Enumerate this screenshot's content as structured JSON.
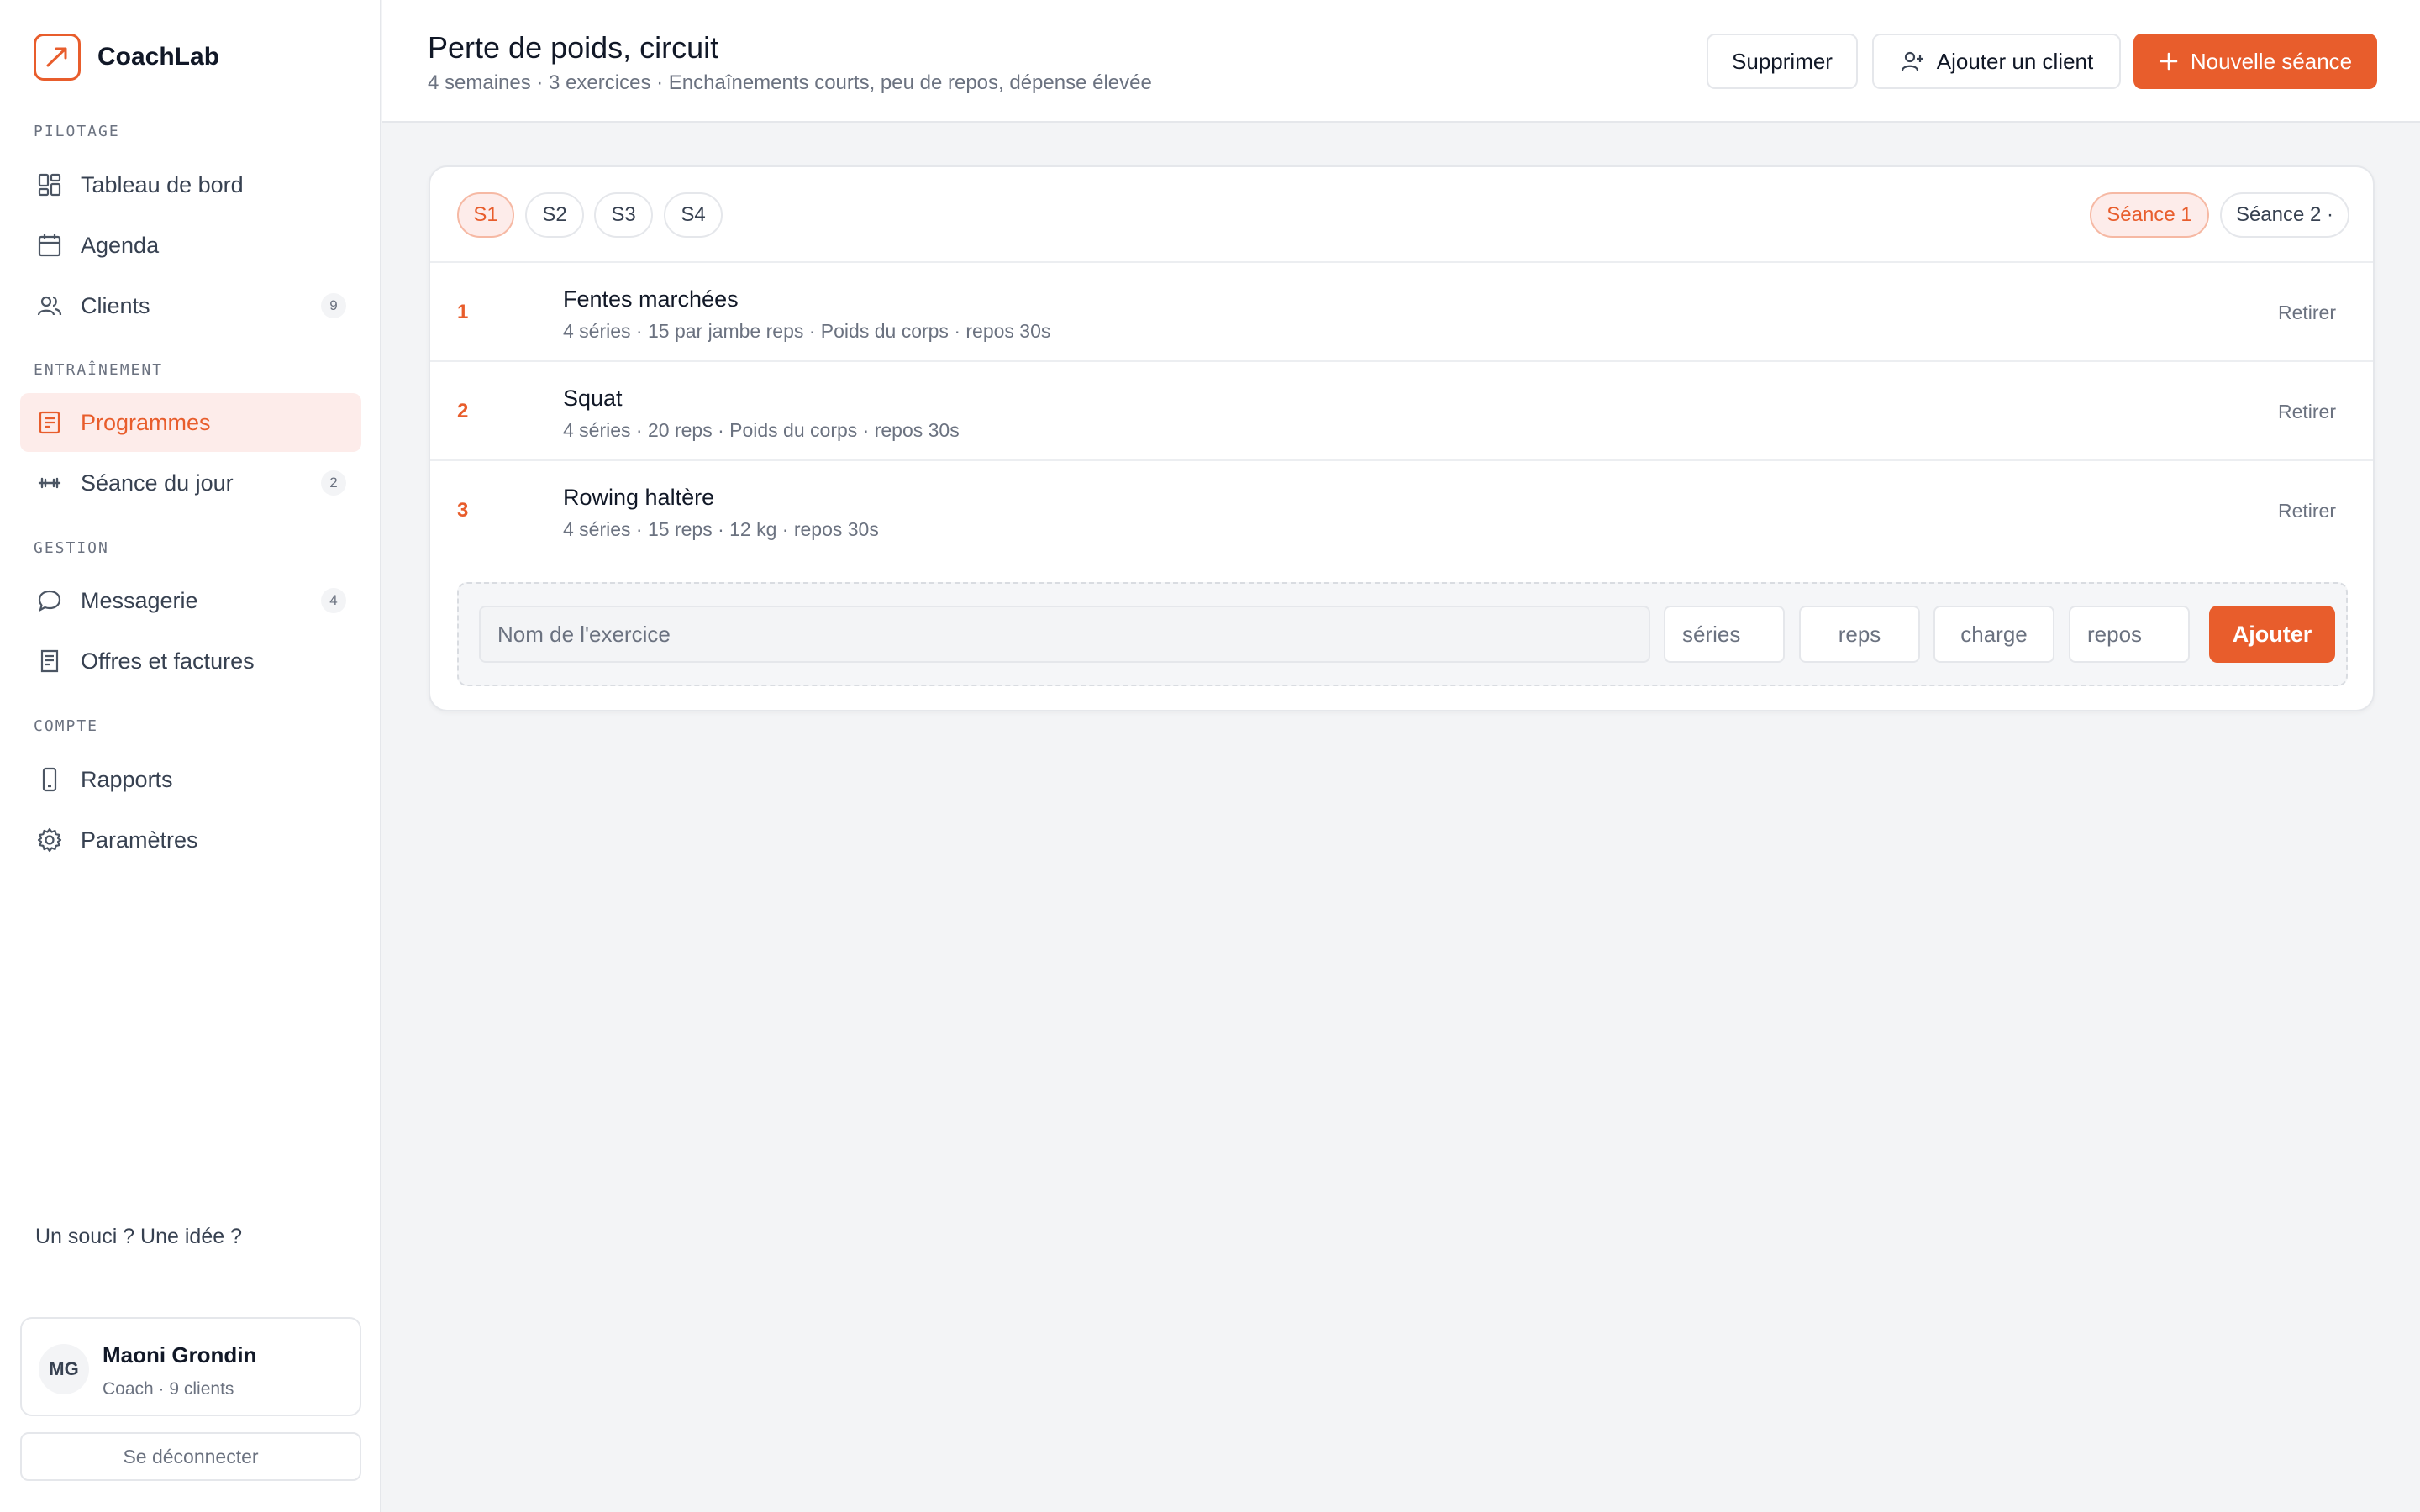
{
  "brand": {
    "name": "CoachLab",
    "logo_icon": "trend-arrow-icon",
    "accent": "#e85d2c"
  },
  "sidebar": {
    "sections": [
      {
        "title": "PILOTAGE"
      },
      {
        "title": "ENTRAÎNEMENT"
      },
      {
        "title": "GESTION"
      },
      {
        "title": "COMPTE"
      }
    ],
    "items": [
      {
        "label": "Tableau de bord",
        "icon": "dashboard-icon"
      },
      {
        "label": "Agenda",
        "icon": "calendar-icon"
      },
      {
        "label": "Clients",
        "icon": "users-icon",
        "badge": "9"
      },
      {
        "label": "Programmes",
        "icon": "document-icon",
        "active": true
      },
      {
        "label": "Séance du jour",
        "icon": "dumbbell-icon",
        "badge": "2"
      },
      {
        "label": "Messagerie",
        "icon": "chat-icon",
        "badge": "4"
      },
      {
        "label": "Offres et factures",
        "icon": "receipt-icon"
      },
      {
        "label": "Rapports",
        "icon": "phone-icon"
      },
      {
        "label": "Paramètres",
        "icon": "gear-icon"
      }
    ],
    "feedback": "Un souci ? Une idée ?",
    "user": {
      "initials": "MG",
      "name": "Maoni Grondin",
      "subtitle": "Coach · 9 clients"
    },
    "logout": "Se déconnecter"
  },
  "header": {
    "title": "Perte de poids, circuit",
    "subtitle": "4 semaines · 3 exercices · Enchaînements courts, peu de repos, dépense élevée",
    "delete_label": "Supprimer",
    "add_client_label": "Ajouter un client",
    "new_session_label": "Nouvelle séance"
  },
  "program": {
    "weeks": [
      "S1",
      "S2",
      "S3",
      "S4"
    ],
    "active_week": "S1",
    "sessions": [
      "Séance 1",
      "Séance 2 ·"
    ],
    "active_session": "Séance 1",
    "exercises": [
      {
        "num": "1",
        "name": "Fentes marchées",
        "meta": "4 séries · 15 par jambe reps · Poids du corps · repos 30s",
        "remove": "Retirer"
      },
      {
        "num": "2",
        "name": "Squat",
        "meta": "4 séries · 20 reps · Poids du corps · repos 30s",
        "remove": "Retirer"
      },
      {
        "num": "3",
        "name": "Rowing haltère",
        "meta": "4 séries · 15 reps · 12 kg · repos 30s",
        "remove": "Retirer"
      }
    ],
    "add_form": {
      "name_placeholder": "Nom de l'exercice",
      "sets_placeholder": "séries",
      "reps_placeholder": "reps",
      "load_placeholder": "charge",
      "rest_placeholder": "repos",
      "submit_label": "Ajouter"
    }
  }
}
